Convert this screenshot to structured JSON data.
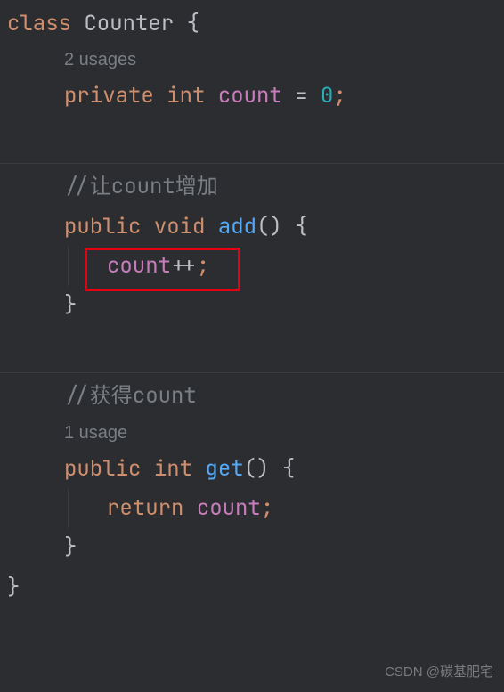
{
  "code": {
    "line1": {
      "keyword": "class",
      "className": "Counter",
      "brace": "{"
    },
    "usages1": "2 usages",
    "line2": {
      "modifier": "private",
      "type": "int",
      "field": "count",
      "equals": "=",
      "value": "0",
      "semi": ";"
    },
    "comment1": "//让count增加",
    "line3": {
      "modifier": "public",
      "returnType": "void",
      "method": "add",
      "parens": "()",
      "brace": "{"
    },
    "line4": {
      "field": "count",
      "op": "++",
      "semi": ";"
    },
    "closeBrace1": "}",
    "comment2": "//获得count",
    "usages2": "1 usage",
    "line5": {
      "modifier": "public",
      "returnType": "int",
      "method": "get",
      "parens": "()",
      "brace": "{"
    },
    "line6": {
      "keyword": "return",
      "field": "count",
      "semi": ";"
    },
    "closeBrace2": "}",
    "closeBrace3": "}"
  },
  "watermark": "CSDN @碳基肥宅"
}
